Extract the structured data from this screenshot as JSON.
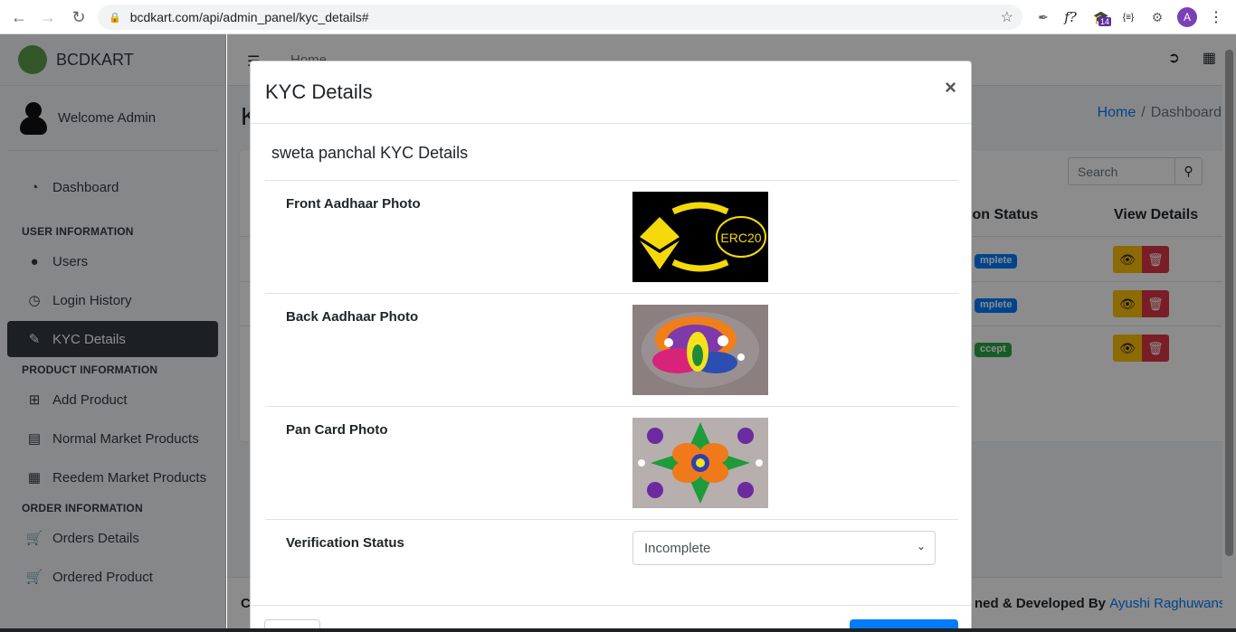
{
  "browser": {
    "url": "bcdkart.com/api/admin_panel/kyc_details#",
    "ext_badge": "14",
    "ext_braces": "{≡}",
    "ext_f": "f?",
    "avatar_letter": "A"
  },
  "sidebar": {
    "brand": "BCDKART",
    "user_welcome": "Welcome  Admin",
    "dashboard": "Dashboard",
    "sections": {
      "user_info": "USER INFORMATION",
      "product_info": "PRODUCT INFORMATION",
      "order_info": "ORDER INFORMATION"
    },
    "items": {
      "users": "Users",
      "login_history": "Login History",
      "kyc_details": "KYC Details",
      "add_product": "Add Product",
      "normal_market": "Normal Market Products",
      "reedem_market": "Reedem Market Products",
      "orders_details": "Orders Details",
      "ordered_product": "Ordered Product"
    }
  },
  "main": {
    "top_home": "Home",
    "page_title": "K",
    "breadcrumb_home": "Home",
    "breadcrumb_sep": "/",
    "breadcrumb_current": "Dashboard",
    "search_placeholder": "Search",
    "col_status": "ion Status",
    "col_view": "View Details",
    "rows": [
      {
        "status": "mplete",
        "color": "#007bff"
      },
      {
        "status": "mplete",
        "color": "#007bff"
      },
      {
        "status": "ccept",
        "color": "#28a745"
      }
    ],
    "footer_left": "C",
    "footer_right": "ned & Developed By ",
    "footer_link": "Ayushi Raghuwanshi"
  },
  "modal": {
    "title": "KYC Details",
    "close": "×",
    "subtitle": "sweta panchal KYC Details",
    "front_label": "Front Aadhaar Photo",
    "back_label": "Back Aadhaar Photo",
    "pan_label": "Pan Card Photo",
    "status_label": "Verification Status",
    "status_value": "Incomplete",
    "front_img_text": "ERC20"
  },
  "colors": {
    "primary": "#007bff",
    "warning": "#ffc107",
    "danger": "#dc3545",
    "success": "#28a745",
    "sidebar_active": "#343a40"
  }
}
